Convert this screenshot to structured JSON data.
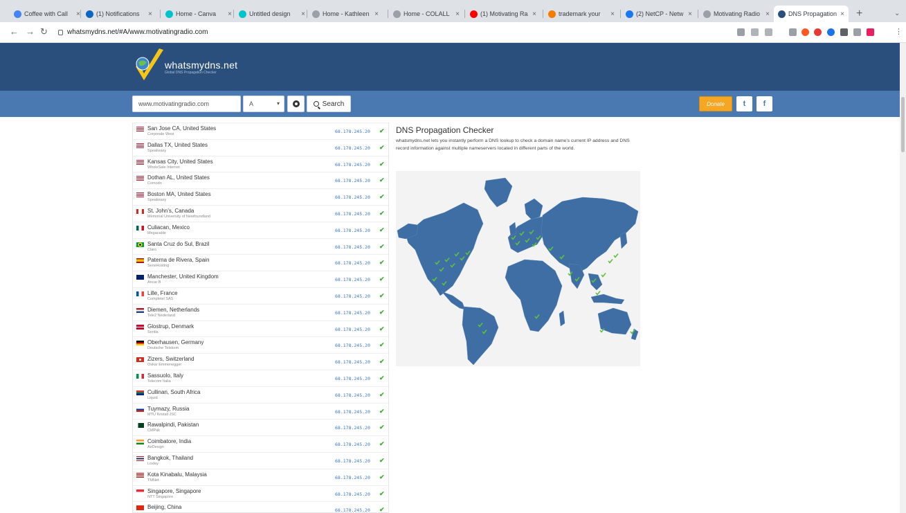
{
  "browser": {
    "tabs": [
      {
        "label": "Coffee with Call",
        "favicon_color": "#4285f4"
      },
      {
        "label": "(1) Notifications",
        "favicon_color": "#0a66c2"
      },
      {
        "label": "Home - Canva",
        "favicon_color": "#00c4cc"
      },
      {
        "label": "Untitled design",
        "favicon_color": "#00c4cc"
      },
      {
        "label": "Home - Kathleen",
        "favicon_color": "#9aa0a6"
      },
      {
        "label": "Home - COLALL",
        "favicon_color": "#9aa0a6"
      },
      {
        "label": "(1) Motivating Ra",
        "favicon_color": "#ff0000"
      },
      {
        "label": "trademark your",
        "favicon_color": "#f57c00"
      },
      {
        "label": "(2) NetCP - Netw",
        "favicon_color": "#1877f2"
      },
      {
        "label": "Motivating Radio",
        "favicon_color": "#9aa0a6"
      },
      {
        "label": "DNS Propagation",
        "favicon_color": "#2b4f7c"
      }
    ],
    "active_tab": 10,
    "url": "whatsmydns.net/#A/www.motivatingradio.com"
  },
  "site": {
    "logo_text": "whatsmydns.net",
    "logo_tagline": "Global DNS Propagation Checker",
    "domain_value": "www.motivatingradio.com",
    "record_type": "A",
    "search_label": "Search",
    "donate_label": "Donate",
    "twitter_label": "t",
    "facebook_label": "f",
    "brand_color": "#2b4f7c",
    "bar_color": "#4a78b0"
  },
  "info": {
    "title": "DNS Propagation Checker",
    "description": "whatsmydns.net lets you instantly perform a DNS lookup to check a domain name's current IP address and DNS record information against multiple nameservers located in different parts of the world."
  },
  "results": [
    {
      "location": "San Jose CA, United States",
      "provider": "Corporate West",
      "ip": "68.178.245.20",
      "flag": "us"
    },
    {
      "location": "Dallas TX, United States",
      "provider": "Speakeasy",
      "ip": "68.178.245.20",
      "flag": "us"
    },
    {
      "location": "Kansas City, United States",
      "provider": "WholeSale Internet",
      "ip": "68.178.245.20",
      "flag": "us"
    },
    {
      "location": "Dothan AL, United States",
      "provider": "Comodo",
      "ip": "68.178.245.20",
      "flag": "us"
    },
    {
      "location": "Boston MA, United States",
      "provider": "Speakeasy",
      "ip": "68.178.245.20",
      "flag": "us"
    },
    {
      "location": "St. John's, Canada",
      "provider": "Memorial University of Newfoundland",
      "ip": "68.178.245.20",
      "flag": "ca"
    },
    {
      "location": "Culiacan, Mexico",
      "provider": "Megacable",
      "ip": "68.178.245.20",
      "flag": "mx"
    },
    {
      "location": "Santa Cruz do Sul, Brazil",
      "provider": "Claro",
      "ip": "68.178.245.20",
      "flag": "br"
    },
    {
      "location": "Paterna de Rivera, Spain",
      "provider": "ServiHosting",
      "ip": "68.178.245.20",
      "flag": "es"
    },
    {
      "location": "Manchester, United Kingdom",
      "provider": "Ancar B",
      "ip": "68.178.245.20",
      "flag": "gb"
    },
    {
      "location": "Lille, France",
      "provider": "Completel SAS",
      "ip": "68.178.245.20",
      "flag": "fr"
    },
    {
      "location": "Diemen, Netherlands",
      "provider": "Tele2 Nederland",
      "ip": "68.178.245.20",
      "flag": "nl"
    },
    {
      "location": "Glostrup, Denmark",
      "provider": "Sentia",
      "ip": "68.178.245.20",
      "flag": "dk"
    },
    {
      "location": "Oberhausen, Germany",
      "provider": "Deutsche Telekom",
      "ip": "68.178.245.20",
      "flag": "de"
    },
    {
      "location": "Zizers, Switzerland",
      "provider": "Oskar Emmenegger",
      "ip": "68.178.245.20",
      "flag": "ch"
    },
    {
      "location": "Sassuolo, Italy",
      "provider": "Telecom Italia",
      "ip": "68.178.245.20",
      "flag": "it"
    },
    {
      "location": "Cullinan, South Africa",
      "provider": "Liquid",
      "ip": "68.178.245.20",
      "flag": "za"
    },
    {
      "location": "Tuymazy, Russia",
      "provider": "MTU Kristall JSC",
      "ip": "68.178.245.20",
      "flag": "ru"
    },
    {
      "location": "Rawalpindi, Pakistan",
      "provider": "CMPak",
      "ip": "68.178.245.20",
      "flag": "pk"
    },
    {
      "location": "Coimbatore, India",
      "provider": "AirDesign",
      "ip": "68.178.245.20",
      "flag": "in"
    },
    {
      "location": "Bangkok, Thailand",
      "provider": "Loxley",
      "ip": "68.178.245.20",
      "flag": "th"
    },
    {
      "location": "Kota Kinabalu, Malaysia",
      "provider": "TMNet",
      "ip": "68.178.245.20",
      "flag": "my"
    },
    {
      "location": "Singapore, Singapore",
      "provider": "NTT Singapore",
      "ip": "68.178.245.20",
      "flag": "sg"
    },
    {
      "location": "Beijing, China",
      "provider": "",
      "ip": "68.178.245.20",
      "flag": "cn"
    }
  ],
  "map": {
    "land_color": "#3e6ea3",
    "marker_color": "#5cc23d"
  }
}
